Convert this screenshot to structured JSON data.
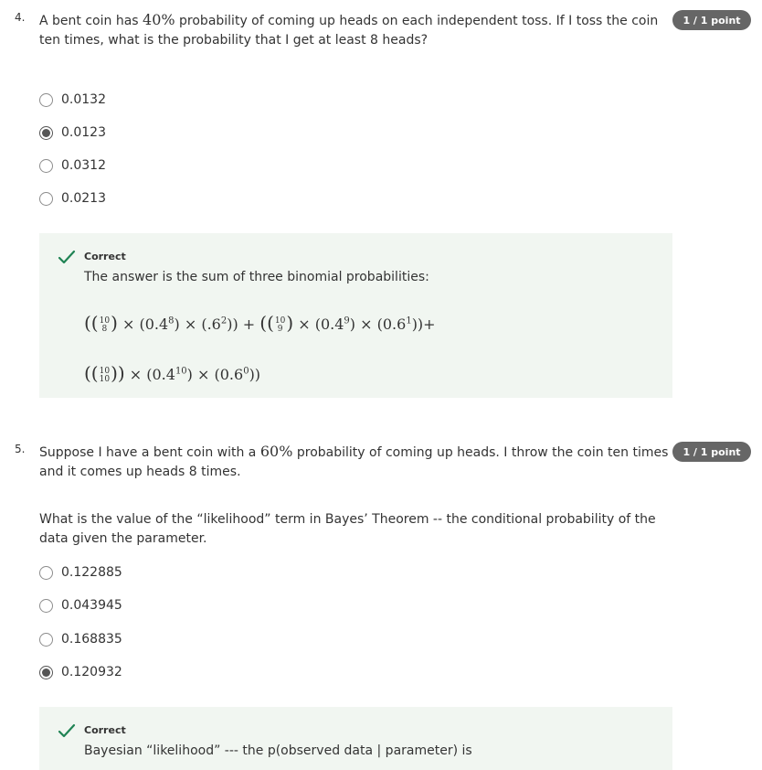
{
  "q4": {
    "number": "4.",
    "text_a": "A bent coin has ",
    "text_pct": "40%",
    "text_b": " probability of coming up heads on each independent toss. If I toss the coin ten times, what is the probability that I get at least 8 heads?",
    "badge": "1 / 1 point",
    "options": [
      "0.0132",
      "0.0123",
      "0.0312",
      "0.0213"
    ],
    "selected_index": 1,
    "feedback": {
      "title": "Correct",
      "text": "The answer is the sum of three binomial probabilities:"
    }
  },
  "q5": {
    "number": "5.",
    "text_a": "Suppose I have a bent coin with a ",
    "text_pct": "60%",
    "text_b": " probability of coming up heads. I throw the coin ten times and it comes up heads 8 times.",
    "text2": "What is the value of the “likelihood” term in Bayes’ Theorem -- the conditional probability of the data given the parameter.",
    "badge": "1 / 1 point",
    "options": [
      "0.122885",
      "0.043945",
      "0.168835",
      "0.120932"
    ],
    "selected_index": 3,
    "feedback": {
      "title": "Correct",
      "text": "Bayesian “likelihood” --- the p(observed data | parameter) is"
    }
  },
  "colors": {
    "badge_bg": "#666666",
    "feedback_bg": "#f1f6f1",
    "check": "#1f8354"
  }
}
